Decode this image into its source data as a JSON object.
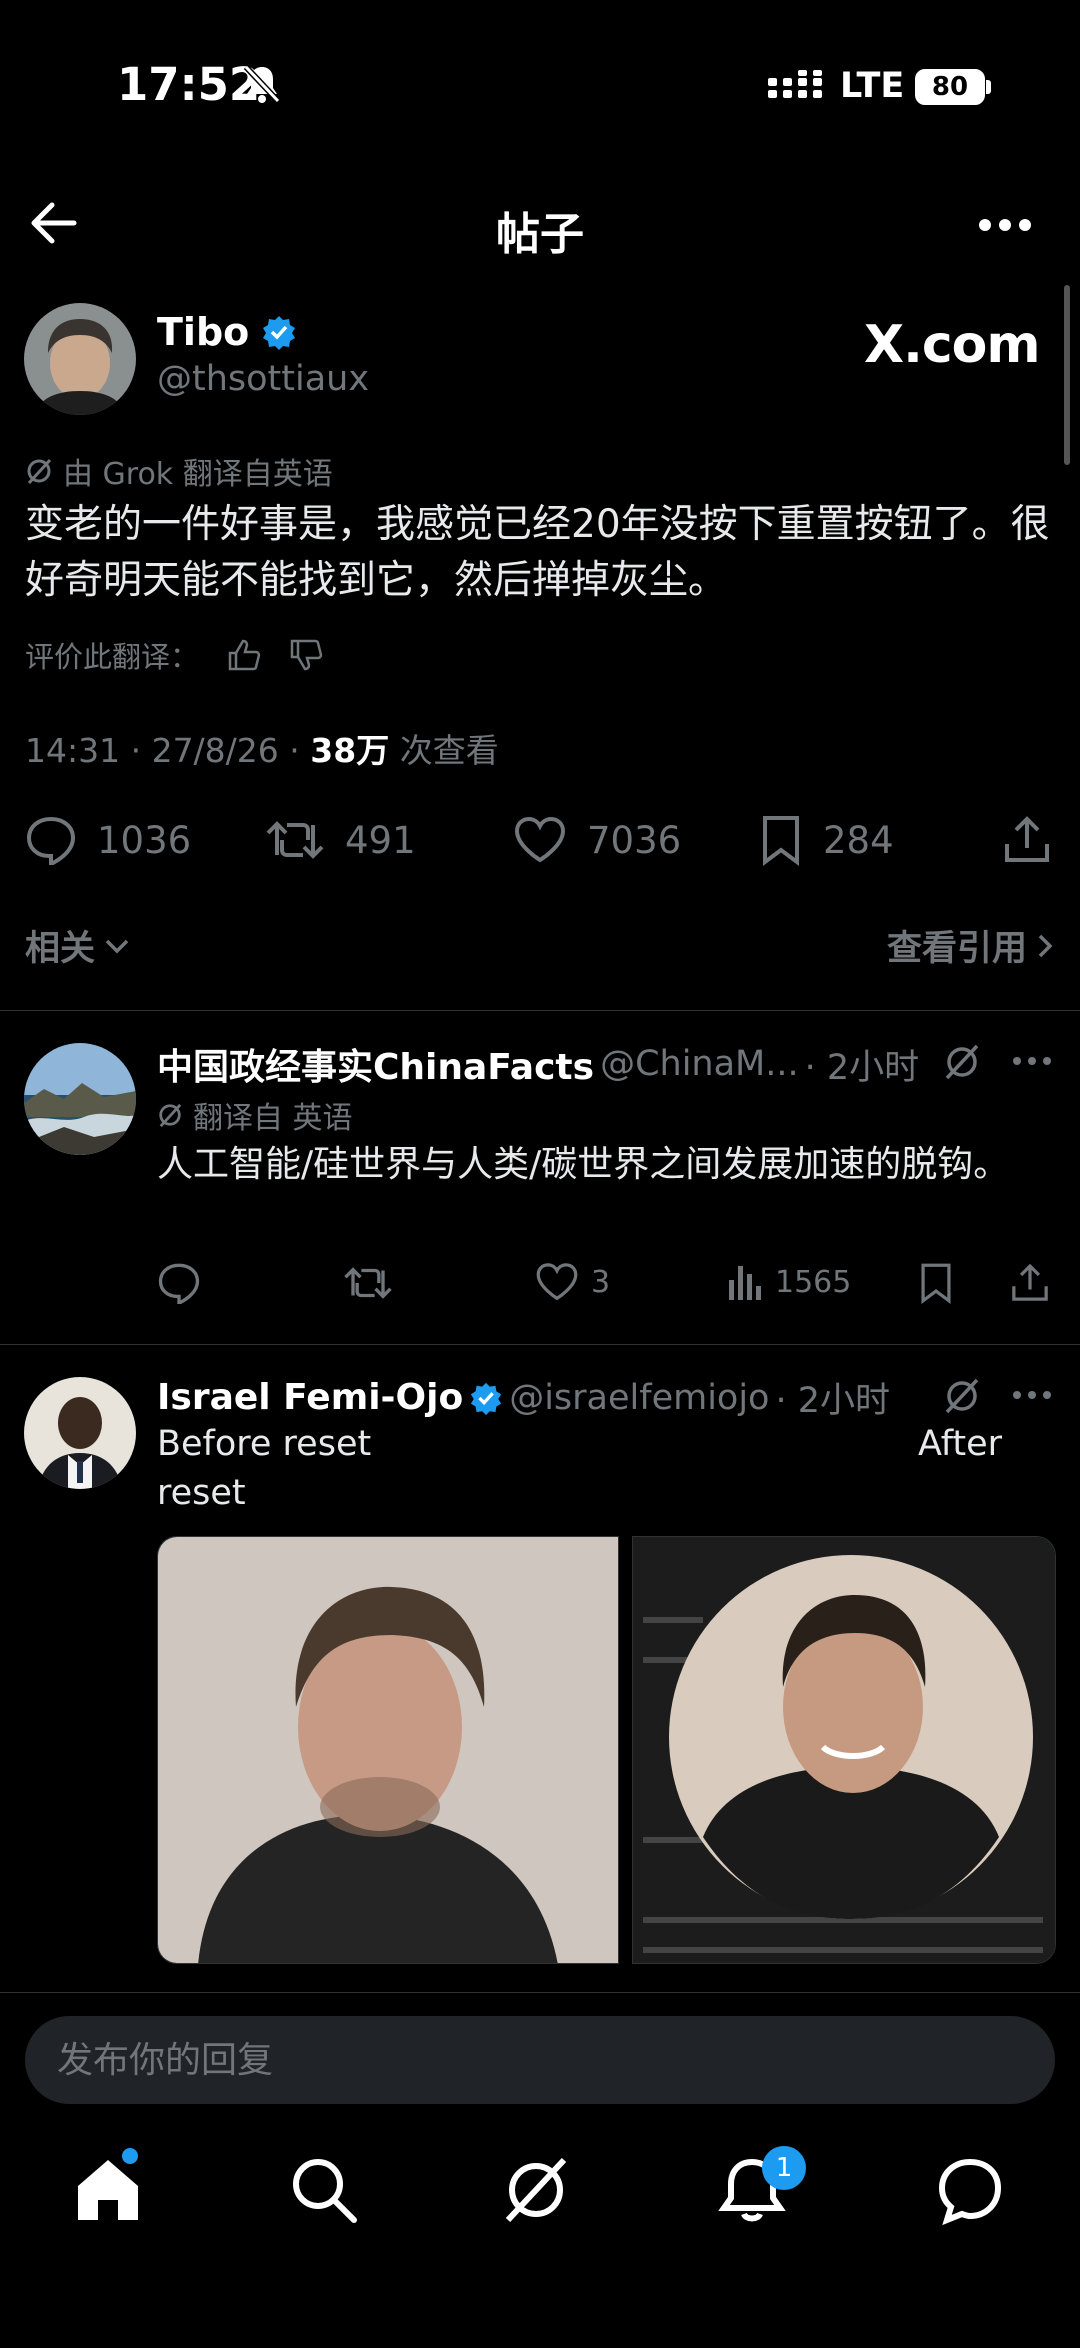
{
  "status": {
    "time": "17:52",
    "network": "LTE",
    "battery": "80"
  },
  "header": {
    "title": "帖子"
  },
  "post": {
    "author_name": "Tibo",
    "handle": "@thsottiaux",
    "brand": "X.com",
    "translated_note": "由 Grok 翻译自英语",
    "text": "变老的一件好事是，我感觉已经20年没按下重置按钮了。很好奇明天能不能找到它，然后掸掉灰尘。",
    "rate_label": "评价此翻译：",
    "meta_time": "14:31 · 27/8/26 · ",
    "views": "38万",
    "views_label": " 次查看",
    "replies": "1036",
    "reposts": "491",
    "likes": "7036",
    "bookmarks": "284",
    "related_label": "相关",
    "quotes_label": "查看引用"
  },
  "replies": [
    {
      "name": "中国政经事实ChinaFacts",
      "handle": "@ChinaM...",
      "time": "· 2小时",
      "translated_note": "翻译自 英语",
      "text": "人工智能/硅世界与人类/碳世界之间发展加速的脱钩。",
      "likes": "3",
      "views": "1565"
    },
    {
      "name": "Israel Femi-Ojo",
      "handle": "@israelfemiojo",
      "time": "· 2小时",
      "text_line1": "Before reset",
      "text_after": "After",
      "text_line2": "reset"
    }
  ],
  "compose": {
    "placeholder": "发布你的回复"
  },
  "tabbar": {
    "notifications_badge": "1"
  },
  "colors": {
    "accent": "#1d9bf0",
    "background": "#000000",
    "muted": "#71767b"
  }
}
